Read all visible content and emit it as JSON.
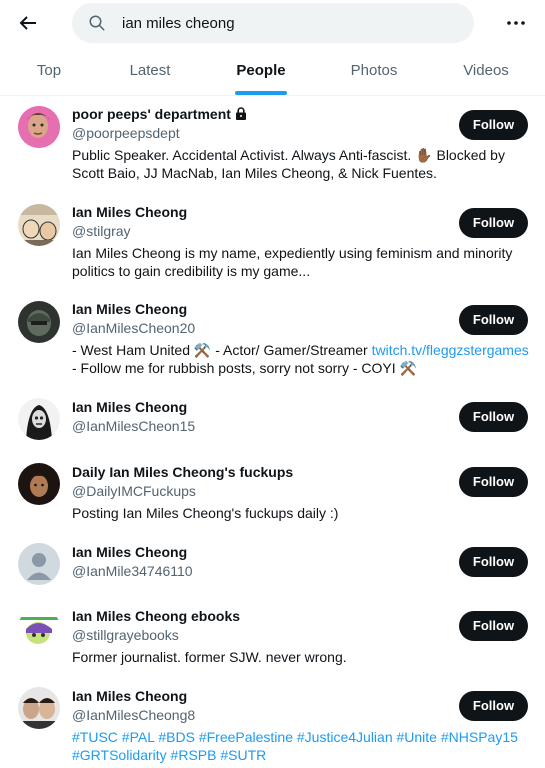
{
  "search": {
    "value": "ian miles cheong"
  },
  "tabs": [
    {
      "label": "Top"
    },
    {
      "label": "Latest"
    },
    {
      "label": "People"
    },
    {
      "label": "Photos"
    },
    {
      "label": "Videos"
    }
  ],
  "follow_label": "Follow",
  "results": [
    {
      "name": "poor peeps' department",
      "handle": "@poorpeepsdept",
      "bio": [
        "Public Speaker. Accidental Activist. Always Anti-fascist. ✋🏾 Blocked by",
        "Scott Baio, JJ MacNab, Ian Miles Cheong, & Nick Fuentes."
      ]
    },
    {
      "name": "Ian Miles Cheong",
      "handle": "@stilgray",
      "bio": [
        "Ian Miles Cheong is my name, expediently using feminism and minority",
        "politics to gain credibility is my game..."
      ]
    },
    {
      "name": "Ian Miles Cheong",
      "handle": "@IanMilesCheon20",
      "bio_line1": "- West Ham United ⚒️ - Actor/ Gamer/Streamer ",
      "bio_link": "twitch.tv/fleggzstergames",
      "bio_line2": "- Follow me for rubbish posts, sorry not sorry - COYI ⚒️"
    },
    {
      "name": "Ian Miles Cheong",
      "handle": "@IanMilesCheon15"
    },
    {
      "name": "Daily Ian Miles Cheong's fuckups",
      "handle": "@DailyIMCFuckups",
      "bio": [
        "Posting Ian Miles Cheong's fuckups daily :)"
      ]
    },
    {
      "name": "Ian Miles Cheong",
      "handle": "@IanMile34746110"
    },
    {
      "name": "Ian Miles Cheong ebooks",
      "handle": "@stillgrayebooks",
      "bio": [
        "Former journalist. former SJW. never wrong."
      ]
    },
    {
      "name": "Ian Miles Cheong",
      "handle": "@IanMilesCheong8",
      "bio_hashtags": [
        "#TUSC #PAL #BDS #FreePalestine #Justice4Julian #Unite #NHSPay15",
        "#GRTSolidarity #RSPB #SUTR"
      ]
    }
  ],
  "colors": {
    "accent": "#1d9bf0",
    "follow_bg": "#0f1419",
    "secondary_text": "#536471"
  }
}
